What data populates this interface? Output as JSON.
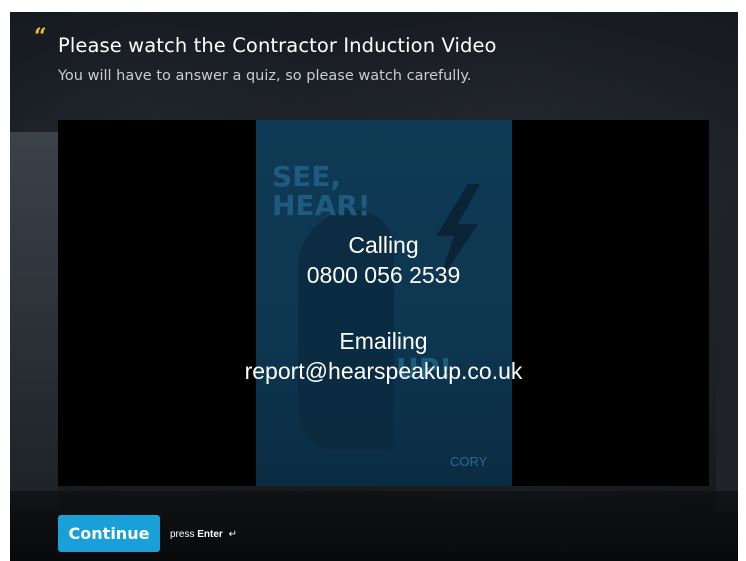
{
  "question": {
    "quote_icon": "quote-icon",
    "title": "Please watch the Contractor Induction Video",
    "subtitle": "You will have to answer a quiz, so please watch carefully."
  },
  "video": {
    "poster": {
      "heading_line1": "SEE,",
      "heading_line2": "HEAR!",
      "bottom_line1": "UP!",
      "brand": "CORY"
    },
    "overlay": {
      "line1": "Calling",
      "line2": "0800 056 2539",
      "line3": "Emailing",
      "line4": "report@hearspeakup.co.uk"
    }
  },
  "actions": {
    "continue_label": "Continue",
    "press_prefix": "press",
    "press_key": "Enter",
    "enter_icon": "enter-icon"
  },
  "colors": {
    "accent": "#1aa0d8",
    "quote": "#f2c230"
  }
}
